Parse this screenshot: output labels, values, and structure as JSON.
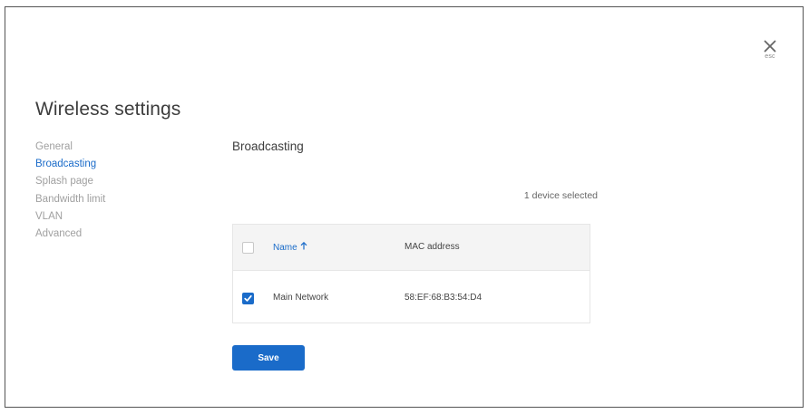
{
  "dialog": {
    "title": "Wireless settings",
    "close_label": "esc"
  },
  "sidebar": {
    "items": [
      {
        "label": "General",
        "active": false
      },
      {
        "label": "Broadcasting",
        "active": true
      },
      {
        "label": "Splash page",
        "active": false
      },
      {
        "label": "Bandwidth limit",
        "active": false
      },
      {
        "label": "VLAN",
        "active": false
      },
      {
        "label": "Advanced",
        "active": false
      }
    ]
  },
  "main": {
    "section_title": "Broadcasting",
    "selection_status": "1 device selected",
    "table": {
      "columns": [
        {
          "label": "Name",
          "sort_icon": "arrow-up-icon"
        },
        {
          "label": "MAC address"
        }
      ],
      "rows": [
        {
          "selected": true,
          "name": "Main Network",
          "mac": "58:EF:68:B3:54:D4"
        }
      ]
    },
    "save_label": "Save"
  },
  "colors": {
    "accent": "#1a6bc9",
    "muted_text": "#a0a0a0",
    "header_bg": "#f4f4f4"
  }
}
